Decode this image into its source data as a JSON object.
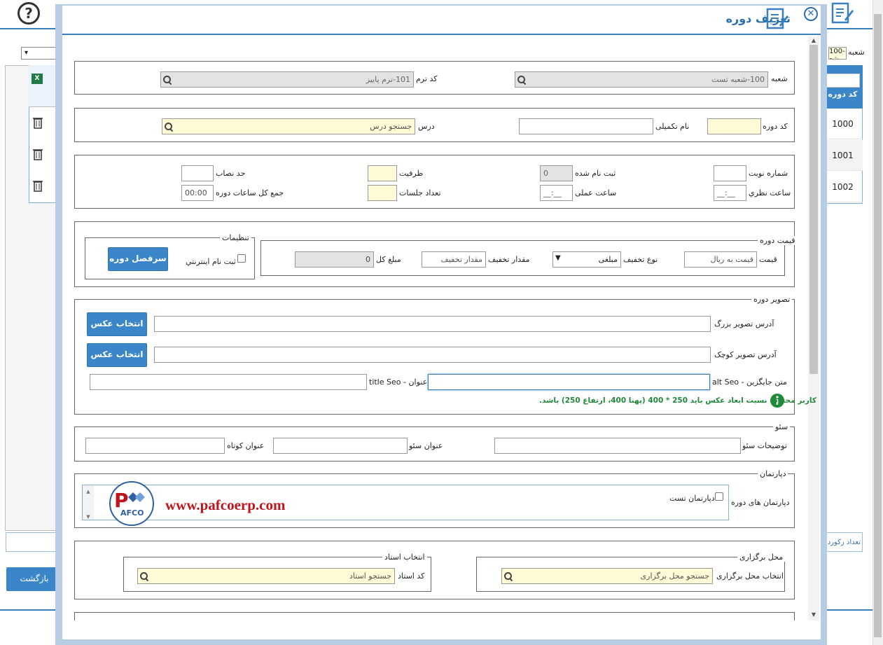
{
  "background": {
    "help_glyph": "?",
    "excel_glyph": "X",
    "branch_label": "شعبه",
    "branch_value": "100-شع",
    "grid_header": "کد دوره",
    "grid_rows": [
      "1000",
      "1001",
      "1002"
    ],
    "record_count_label": "تعداد رکورد",
    "back_button": "بازگشت",
    "select_arrow": "▾"
  },
  "modal": {
    "title": "تعریف دوره",
    "close_glyph": "✕",
    "scroll_up": "▲",
    "scroll_down": "▼"
  },
  "term": {
    "branch_label": "شعبه",
    "branch_value": "100-شعبه تست",
    "term_label": "کد ترم",
    "term_value": "101-ترم پاییز"
  },
  "course": {
    "code_label": "کد دوره",
    "code_value": "",
    "full_name_label": "نام تکمیلی",
    "full_name_value": "",
    "lesson_label": "درس",
    "lesson_placeholder": "جستجو درس"
  },
  "capacity": {
    "turn_label": "شماره نوبت",
    "registered_label": "ثبت نام شده",
    "registered_value": "0",
    "capacity_label": "ظرفیت",
    "quorum_label": "حد نصاب",
    "theory_hours_label": "ساعت نظري",
    "theory_hours_value": "__:__",
    "practical_hours_label": "ساعت عملی",
    "practical_hours_value": "__:__",
    "sessions_label": "تعداد جلسات",
    "total_hours_label": "جمع کل ساعات دوره",
    "total_hours_value": "00:00"
  },
  "price": {
    "legend": "قیمت دوره",
    "price_label": "قیمت",
    "price_placeholder": "قیمت به ریال",
    "discount_type_label": "نوع تخفیف",
    "discount_type_value": "مبلغی",
    "discount_amount_label": "مقدار تخفیف",
    "discount_amount_placeholder": "مقدار تخفیف",
    "total_label": "مبلغ کل",
    "total_value": "0"
  },
  "settings": {
    "legend": "تنظیمات",
    "online_registration_label": "ثبت نام اینترنتي",
    "syllabus_button": "سرفصل دوره"
  },
  "image": {
    "legend": "تصویر دوره",
    "large_label": "آدرس تصویر بزرگ",
    "small_label": "آدرس تصویر کوچک",
    "choose_button": "انتخاب عکس",
    "alt_label": "متن جایگزین - alt Seo",
    "title_label": "عنوان - title Seo",
    "notice": "کاربر محترم، نسبت ابعاد عکس باید 250 * 400 (پهنا 400، ارتفاع 250) باشد."
  },
  "seo": {
    "legend": "سئو",
    "description_label": "توضیحات سئو",
    "title_label": "عنوان سئو",
    "short_title_label": "عنوان کوتاه"
  },
  "department": {
    "legend": "دپارتمان",
    "course_departments_label": "دپارتمان های دوره",
    "item_label": "دپارتمان تست",
    "watermark_url": "www.pafcoerp.com",
    "logo_text": "AFCO"
  },
  "venue": {
    "venue_legend": "محل برگزاری",
    "venue_select_label": "انتخاب محل برگزاری",
    "venue_placeholder": "جستجو محل برگزاری",
    "teacher_legend": "انتخاب استاد",
    "teacher_code_label": "کد استاد",
    "teacher_placeholder": "جستجو استاد"
  },
  "colors": {
    "accent": "#3a86c8",
    "title": "#2a6fb2",
    "notice": "#1f8a3a",
    "watermark": "#c0141c"
  }
}
